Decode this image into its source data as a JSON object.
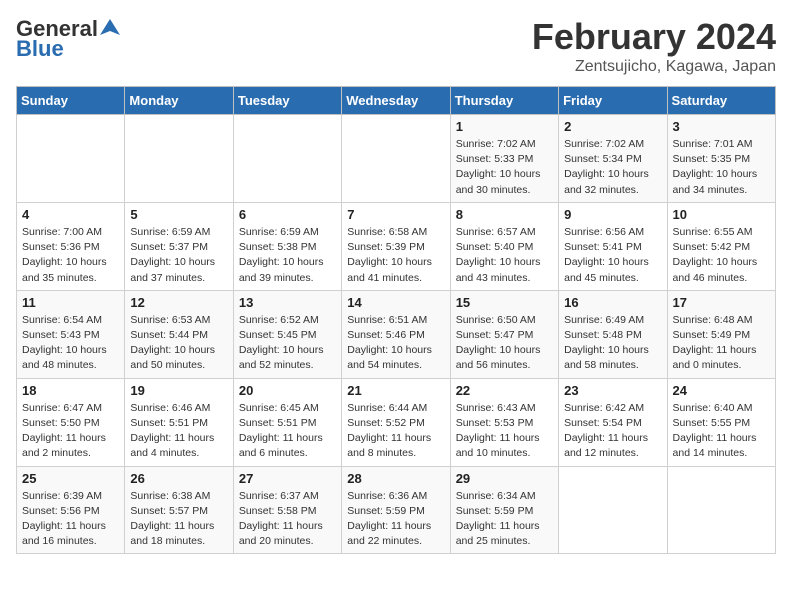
{
  "logo": {
    "general": "General",
    "blue": "Blue"
  },
  "title": {
    "month_year": "February 2024",
    "location": "Zentsujicho, Kagawa, Japan"
  },
  "weekdays": [
    "Sunday",
    "Monday",
    "Tuesday",
    "Wednesday",
    "Thursday",
    "Friday",
    "Saturday"
  ],
  "weeks": [
    [
      {
        "day": "",
        "info": ""
      },
      {
        "day": "",
        "info": ""
      },
      {
        "day": "",
        "info": ""
      },
      {
        "day": "",
        "info": ""
      },
      {
        "day": "1",
        "info": "Sunrise: 7:02 AM\nSunset: 5:33 PM\nDaylight: 10 hours\nand 30 minutes."
      },
      {
        "day": "2",
        "info": "Sunrise: 7:02 AM\nSunset: 5:34 PM\nDaylight: 10 hours\nand 32 minutes."
      },
      {
        "day": "3",
        "info": "Sunrise: 7:01 AM\nSunset: 5:35 PM\nDaylight: 10 hours\nand 34 minutes."
      }
    ],
    [
      {
        "day": "4",
        "info": "Sunrise: 7:00 AM\nSunset: 5:36 PM\nDaylight: 10 hours\nand 35 minutes."
      },
      {
        "day": "5",
        "info": "Sunrise: 6:59 AM\nSunset: 5:37 PM\nDaylight: 10 hours\nand 37 minutes."
      },
      {
        "day": "6",
        "info": "Sunrise: 6:59 AM\nSunset: 5:38 PM\nDaylight: 10 hours\nand 39 minutes."
      },
      {
        "day": "7",
        "info": "Sunrise: 6:58 AM\nSunset: 5:39 PM\nDaylight: 10 hours\nand 41 minutes."
      },
      {
        "day": "8",
        "info": "Sunrise: 6:57 AM\nSunset: 5:40 PM\nDaylight: 10 hours\nand 43 minutes."
      },
      {
        "day": "9",
        "info": "Sunrise: 6:56 AM\nSunset: 5:41 PM\nDaylight: 10 hours\nand 45 minutes."
      },
      {
        "day": "10",
        "info": "Sunrise: 6:55 AM\nSunset: 5:42 PM\nDaylight: 10 hours\nand 46 minutes."
      }
    ],
    [
      {
        "day": "11",
        "info": "Sunrise: 6:54 AM\nSunset: 5:43 PM\nDaylight: 10 hours\nand 48 minutes."
      },
      {
        "day": "12",
        "info": "Sunrise: 6:53 AM\nSunset: 5:44 PM\nDaylight: 10 hours\nand 50 minutes."
      },
      {
        "day": "13",
        "info": "Sunrise: 6:52 AM\nSunset: 5:45 PM\nDaylight: 10 hours\nand 52 minutes."
      },
      {
        "day": "14",
        "info": "Sunrise: 6:51 AM\nSunset: 5:46 PM\nDaylight: 10 hours\nand 54 minutes."
      },
      {
        "day": "15",
        "info": "Sunrise: 6:50 AM\nSunset: 5:47 PM\nDaylight: 10 hours\nand 56 minutes."
      },
      {
        "day": "16",
        "info": "Sunrise: 6:49 AM\nSunset: 5:48 PM\nDaylight: 10 hours\nand 58 minutes."
      },
      {
        "day": "17",
        "info": "Sunrise: 6:48 AM\nSunset: 5:49 PM\nDaylight: 11 hours\nand 0 minutes."
      }
    ],
    [
      {
        "day": "18",
        "info": "Sunrise: 6:47 AM\nSunset: 5:50 PM\nDaylight: 11 hours\nand 2 minutes."
      },
      {
        "day": "19",
        "info": "Sunrise: 6:46 AM\nSunset: 5:51 PM\nDaylight: 11 hours\nand 4 minutes."
      },
      {
        "day": "20",
        "info": "Sunrise: 6:45 AM\nSunset: 5:51 PM\nDaylight: 11 hours\nand 6 minutes."
      },
      {
        "day": "21",
        "info": "Sunrise: 6:44 AM\nSunset: 5:52 PM\nDaylight: 11 hours\nand 8 minutes."
      },
      {
        "day": "22",
        "info": "Sunrise: 6:43 AM\nSunset: 5:53 PM\nDaylight: 11 hours\nand 10 minutes."
      },
      {
        "day": "23",
        "info": "Sunrise: 6:42 AM\nSunset: 5:54 PM\nDaylight: 11 hours\nand 12 minutes."
      },
      {
        "day": "24",
        "info": "Sunrise: 6:40 AM\nSunset: 5:55 PM\nDaylight: 11 hours\nand 14 minutes."
      }
    ],
    [
      {
        "day": "25",
        "info": "Sunrise: 6:39 AM\nSunset: 5:56 PM\nDaylight: 11 hours\nand 16 minutes."
      },
      {
        "day": "26",
        "info": "Sunrise: 6:38 AM\nSunset: 5:57 PM\nDaylight: 11 hours\nand 18 minutes."
      },
      {
        "day": "27",
        "info": "Sunrise: 6:37 AM\nSunset: 5:58 PM\nDaylight: 11 hours\nand 20 minutes."
      },
      {
        "day": "28",
        "info": "Sunrise: 6:36 AM\nSunset: 5:59 PM\nDaylight: 11 hours\nand 22 minutes."
      },
      {
        "day": "29",
        "info": "Sunrise: 6:34 AM\nSunset: 5:59 PM\nDaylight: 11 hours\nand 25 minutes."
      },
      {
        "day": "",
        "info": ""
      },
      {
        "day": "",
        "info": ""
      }
    ]
  ]
}
